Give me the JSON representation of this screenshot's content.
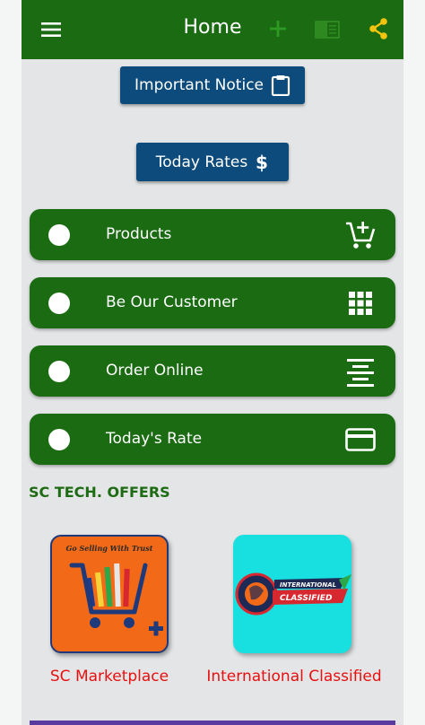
{
  "app_bar": {
    "title": "Home",
    "color": "#1a6b12",
    "icons": [
      "menu-icon",
      "add-icon",
      "book-icon",
      "share-icon"
    ]
  },
  "buttons": {
    "important_notice": "Important Notice",
    "today_rates": "Today Rates"
  },
  "menu_items": [
    {
      "label": "Products",
      "icon": "add-to-cart-icon"
    },
    {
      "label": "Be Our Customer",
      "icon": "apps-grid-icon"
    },
    {
      "label": "Order Online",
      "icon": "align-center-icon"
    },
    {
      "label": "Today's Rate",
      "icon": "credit-card-icon"
    }
  ],
  "offers": {
    "heading": "SC TECH. OFFERS",
    "items": [
      {
        "caption": "SC Marketplace",
        "logo_tagline": "Go Selling With Trust"
      },
      {
        "caption": "International Classified",
        "logo_line1": "INTERNATIONAL",
        "logo_line2": "CLASSIFIED"
      }
    ]
  },
  "colors": {
    "primary_green": "#1a6b12",
    "button_blue": "#0c4b7c",
    "share_yellow": "#f2c40f",
    "caption_red": "#e81010"
  }
}
